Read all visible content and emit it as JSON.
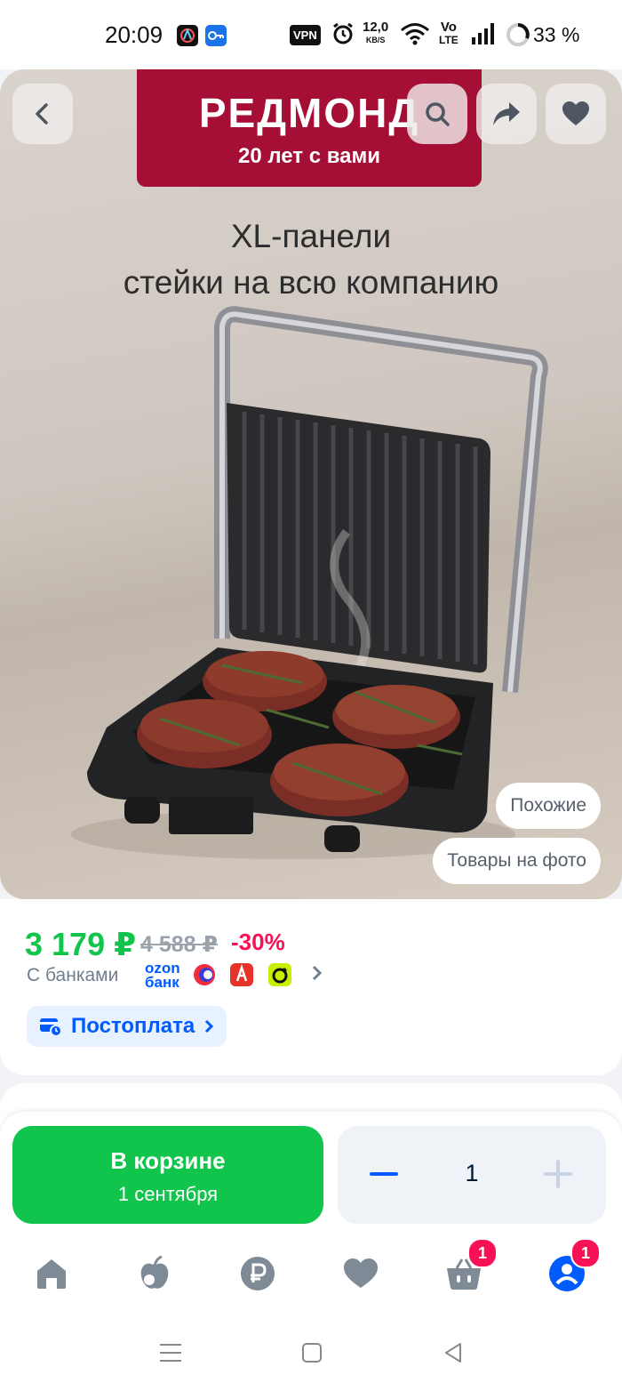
{
  "status_bar": {
    "time": "20:09",
    "vpn": "VPN",
    "speed_value": "12,0",
    "speed_unit": "KB/S",
    "volte": "Vo",
    "lte": "LTE",
    "battery_text": "33 %"
  },
  "hero": {
    "brand_name": "РЕДМОНД",
    "brand_tagline": "20 лет с вами",
    "headline_line1": "XL-панели",
    "headline_line2": "стейки на всю компанию",
    "chips": [
      "Похожие",
      "Товары на фото"
    ]
  },
  "price": {
    "current": "3 179 ₽",
    "old": "4 588 ₽",
    "discount": "-30%",
    "banks_label": "С банками",
    "ozon_bank_line1": "ozon",
    "ozon_bank_line2": "банк",
    "postpay_label": "Постоплата"
  },
  "cart": {
    "button_title": "В корзине",
    "delivery_date": "1 сентября",
    "quantity": "1"
  },
  "bottom_nav": {
    "cart_badge": "1",
    "profile_badge": "1"
  },
  "colors": {
    "ozon_blue": "#005bff",
    "ozon_green": "#10c44c",
    "ozon_pink": "#f91155",
    "redmond_red": "#a50f36"
  },
  "icons": [
    "back-arrow-icon",
    "search-icon",
    "share-icon",
    "favorite-heart-icon",
    "home-icon",
    "apple-icon",
    "ruble-icon",
    "heart-icon",
    "basket-icon",
    "profile-icon"
  ]
}
